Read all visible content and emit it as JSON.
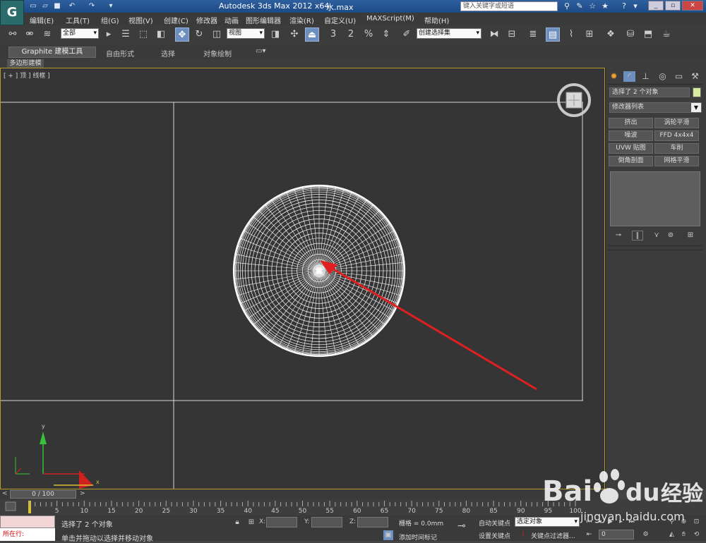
{
  "titlebar": {
    "logo": "G",
    "app_title": "Autodesk 3ds Max  2012 x64",
    "file_name": "水.max",
    "search_placeholder": "键入关键字或短语",
    "quick_access_icons": [
      "new-file-icon",
      "open-folder-icon",
      "save-icon",
      "undo-icon",
      "redo-icon",
      "more-icon"
    ]
  },
  "menu": [
    "编辑(E)",
    "工具(T)",
    "组(G)",
    "视图(V)",
    "创建(C)",
    "修改器",
    "动画",
    "图形编辑器",
    "渲染(R)",
    "自定义(U)",
    "MAXScript(M)",
    "帮助(H)"
  ],
  "toolbar": {
    "selection_filter": "全部",
    "ref_coord": "视图",
    "snap_3": "3",
    "snap_angle_2": "2",
    "snap_percent": "%",
    "selection_set": "创建选择集"
  },
  "ribbon": {
    "tabs": [
      "Graphite 建模工具",
      "自由形式",
      "选择",
      "对象绘制"
    ],
    "sub_label": "多边形建模"
  },
  "viewport": {
    "label": "[ + ] 顶 ] 线框 ]",
    "axis_y": "y",
    "axis_x": "x"
  },
  "command_panel": {
    "object_name": "选择了 2 个对象",
    "object_color": "#d6eaa0",
    "modifier_list": "修改器列表",
    "modifier_buttons": [
      "挤出",
      "涡轮平滑",
      "噪波",
      "FFD 4x4x4",
      "UVW 贴图",
      "车削",
      "倒角剖面",
      "网格平滑"
    ]
  },
  "timeline": {
    "slider": "0 / 100",
    "ticks": [
      0,
      5,
      10,
      15,
      20,
      25,
      30,
      35,
      40,
      45,
      50,
      55,
      60,
      65,
      70,
      75,
      80,
      85,
      90,
      95,
      100
    ]
  },
  "status": {
    "running_label": "所在行:",
    "selected": "选择了 2 个对象",
    "prompt": "单击并拖动以选择并移动对象",
    "x_label": "X:",
    "y_label": "Y:",
    "z_label": "Z:",
    "grid": "栅格 = 0.0mm",
    "add_time_tag": "添加时间标记",
    "auto_key": "自动关键点",
    "set_key": "设置关键点",
    "selected_object": "选定对象",
    "key_filters": "关键点过滤器...",
    "frame": "0"
  },
  "watermark": {
    "brand": "Bai",
    "brand2": "du",
    "cn": "经验",
    "url": "jingyan.baidu.com"
  },
  "colors": {
    "viewport_border": "#b39b2a",
    "arrow": "#e02020",
    "axis_green": "#3ac03a",
    "axis_red": "#d02020"
  }
}
